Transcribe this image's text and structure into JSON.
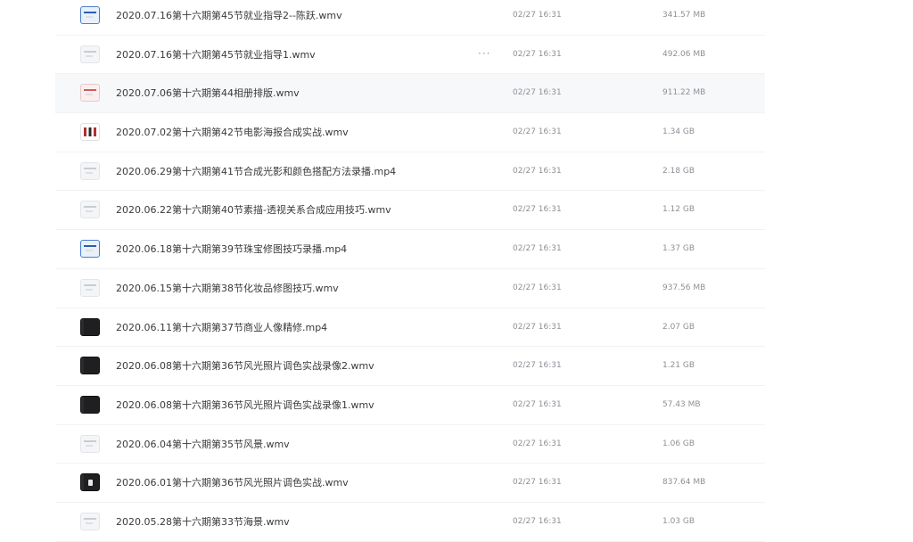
{
  "files": [
    {
      "name": "2020.07.16第十六期第45节就业指导2--陈跃.wmv",
      "modified": "02/27 16:31",
      "size": "341.57 MB",
      "thumb_icon": "video-thumbnail-icon"
    },
    {
      "name": "2020.07.16第十六期第45节就业指导1.wmv",
      "modified": "02/27 16:31",
      "size": "492.06 MB",
      "thumb_icon": "video-thumbnail-icon",
      "more_label": "···"
    },
    {
      "name": "2020.07.06第十六期第44相册排版.wmv",
      "modified": "02/27 16:31",
      "size": "911.22 MB",
      "thumb_icon": "video-thumbnail-icon"
    },
    {
      "name": "2020.07.02第十六期第42节电影海报合成实战.wmv",
      "modified": "02/27 16:31",
      "size": "1.34 GB",
      "thumb_icon": "video-thumbnail-icon"
    },
    {
      "name": "2020.06.29第十六期第41节合成光影和颜色搭配方法录播.mp4",
      "modified": "02/27 16:31",
      "size": "2.18 GB",
      "thumb_icon": "video-thumbnail-icon"
    },
    {
      "name": "2020.06.22第十六期第40节素描-透视关系合成应用技巧.wmv",
      "modified": "02/27 16:31",
      "size": "1.12 GB",
      "thumb_icon": "video-thumbnail-icon"
    },
    {
      "name": "2020.06.18第十六期第39节珠宝修图技巧录播.mp4",
      "modified": "02/27 16:31",
      "size": "1.37 GB",
      "thumb_icon": "video-thumbnail-icon"
    },
    {
      "name": "2020.06.15第十六期第38节化妆品修图技巧.wmv",
      "modified": "02/27 16:31",
      "size": "937.56 MB",
      "thumb_icon": "video-thumbnail-icon"
    },
    {
      "name": "2020.06.11第十六期第37节商业人像精修.mp4",
      "modified": "02/27 16:31",
      "size": "2.07 GB",
      "thumb_icon": "video-thumbnail-icon"
    },
    {
      "name": "2020.06.08第十六期第36节风光照片调色实战录像2.wmv",
      "modified": "02/27 16:31",
      "size": "1.21 GB",
      "thumb_icon": "video-thumbnail-icon"
    },
    {
      "name": "2020.06.08第十六期第36节风光照片调色实战录像1.wmv",
      "modified": "02/27 16:31",
      "size": "57.43 MB",
      "thumb_icon": "video-thumbnail-icon"
    },
    {
      "name": "2020.06.04第十六期第35节风景.wmv",
      "modified": "02/27 16:31",
      "size": "1.06 GB",
      "thumb_icon": "video-thumbnail-icon"
    },
    {
      "name": "2020.06.01第十六期第36节风光照片调色实战.wmv",
      "modified": "02/27 16:31",
      "size": "837.64 MB",
      "thumb_icon": "video-thumbnail-icon"
    },
    {
      "name": "2020.05.28第十六期第33节海景.wmv",
      "modified": "02/27 16:31",
      "size": "1.03 GB",
      "thumb_icon": "video-thumbnail-icon"
    }
  ],
  "colors": {
    "row_hover": "#f7f8fa",
    "row_divider": "#f1f2f4",
    "name_text": "#3a3a3a",
    "meta_text": "#8d9096"
  }
}
